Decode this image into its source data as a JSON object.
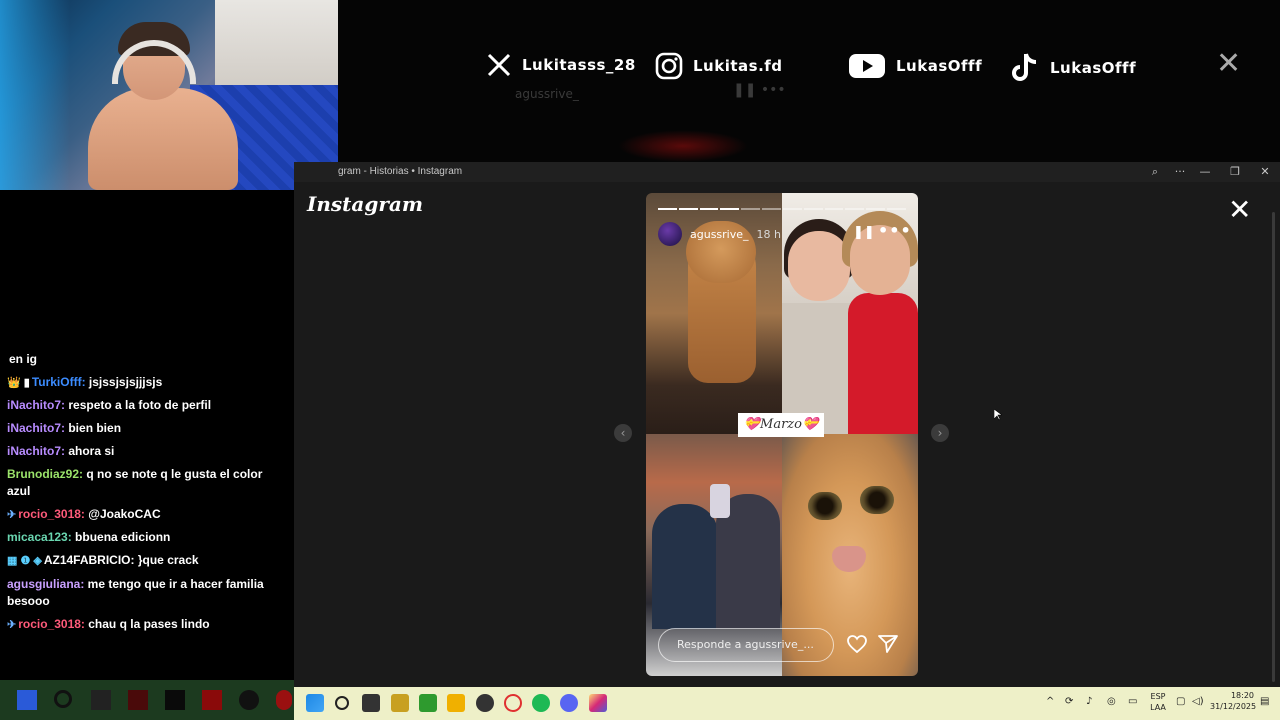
{
  "socials": [
    {
      "network": "x-icon",
      "handle": "Lukitasss_28"
    },
    {
      "network": "instagram-icon",
      "handle": "Lukitas.fd"
    },
    {
      "network": "youtube-icon",
      "handle": "LukasOfff"
    },
    {
      "network": "tiktok-icon",
      "handle": "LukasOfff"
    }
  ],
  "bg_story_user": "agussrive_",
  "chat": [
    {
      "badges": "",
      "user": "",
      "user_color": "#ffffff",
      "text": "en ig"
    },
    {
      "badges": "👑 ▮ ",
      "user": "TurkiOfff:",
      "user_color": "#3c8cff",
      "text": " jsjssjsjsjjjsjs"
    },
    {
      "badges": "",
      "user": "iNachito7:",
      "user_color": "#b88cff",
      "text": " respeto a la foto de perfil"
    },
    {
      "badges": "",
      "user": "iNachito7:",
      "user_color": "#b88cff",
      "text": " bien bien"
    },
    {
      "badges": "",
      "user": "iNachito7:",
      "user_color": "#b88cff",
      "text": " ahora si"
    },
    {
      "badges": "",
      "user": "Brunodiaz92:",
      "user_color": "#9be36a",
      "text": " q no se note q le gusta el color azul"
    },
    {
      "badges": "✈ ",
      "user": "rocio_3018:",
      "user_color": "#ff5a7a",
      "text": " @JoakoCAC"
    },
    {
      "badges": "",
      "user": "micaca123:",
      "user_color": "#6ad6b0",
      "text": " bbuena edicionn"
    },
    {
      "badges": "▦ ❶ ◈ ",
      "user": "AZ14FABRICIO:",
      "user_color": "#ffffff",
      "text": " }que crack"
    },
    {
      "badges": "",
      "user": "agusgiuliana:",
      "user_color": "#c9a0ff",
      "text": " me tengo que ir a hacer familia besooo"
    },
    {
      "badges": "✈ ",
      "user": "rocio_3018:",
      "user_color": "#ff5a7a",
      "text": " chau q la pases lindo"
    }
  ],
  "window": {
    "title": "gram - Historias • Instagram"
  },
  "instagram": {
    "logo": "Instagram",
    "story": {
      "username": "agussrive_",
      "time": "18 h",
      "sticker": "💝Marzo💝",
      "reply_placeholder": "Responde a agussrive_...",
      "progress_total": 12,
      "progress_done": 4
    }
  },
  "taskbar": {
    "lang": "ESP\nLAA",
    "time": "18:20",
    "date": "31/12/2025"
  }
}
